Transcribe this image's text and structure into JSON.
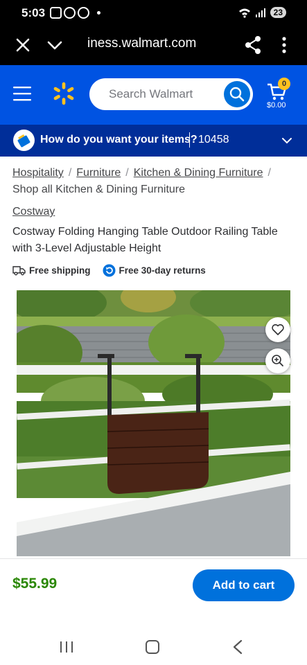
{
  "status_bar": {
    "time": "5:03",
    "battery": "23"
  },
  "browser": {
    "url": "iness.walmart.com"
  },
  "header": {
    "search_placeholder": "Search Walmart",
    "cart_count": "0",
    "cart_total": "$0.00"
  },
  "fulfillment": {
    "question": "How do you want your items?",
    "zip": "10458"
  },
  "breadcrumb": {
    "links": [
      "Hospitality",
      "Furniture",
      "Kitchen & Dining Furniture"
    ],
    "current": "Shop all Kitchen & Dining Furniture"
  },
  "product": {
    "brand": "Costway",
    "title": "Costway Folding Hanging Table Outdoor Railing Table with 3-Level Adjustable Height",
    "benefits": {
      "shipping": "Free shipping",
      "returns": "Free 30-day returns"
    },
    "price": "$55.99",
    "add_to_cart": "Add to cart"
  },
  "colors": {
    "brand_blue": "#0053e2",
    "dark_blue": "#002e99",
    "button_blue": "#0071dc",
    "price_green": "#2a8703",
    "spark_yellow": "#ffc220"
  }
}
